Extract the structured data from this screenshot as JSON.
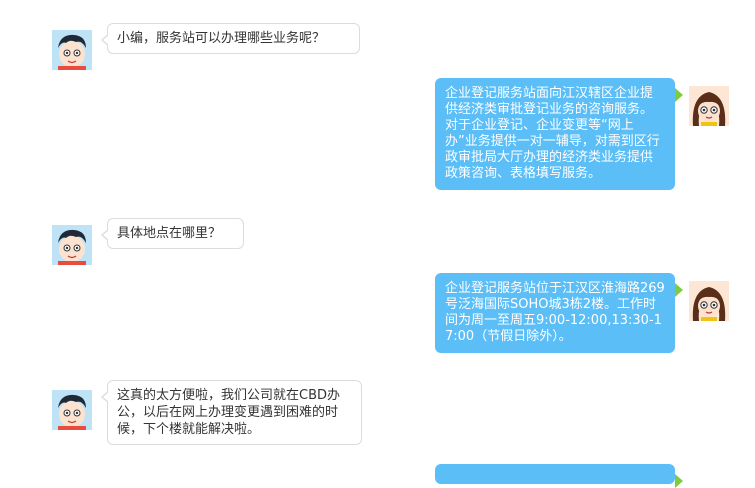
{
  "messages": [
    {
      "side": "user",
      "text": "小编，服务站可以办理哪些业务呢？"
    },
    {
      "side": "agent",
      "text": "企业登记服务站面向江汉辖区企业提供经济类审批登记业务的咨询服务。对于企业登记、企业变更等“网上办”业务提供一对一辅导，对需到区行政审批局大厅办理的经济类业务提供政策咨询、表格填写服务。"
    },
    {
      "side": "user",
      "text": "具体地点在哪里？"
    },
    {
      "side": "agent",
      "text": "企业登记服务站位于江汉区淮海路269号泛海国际SOHO城3栋2楼。工作时间为周一至周五9:00-12:00,13:30-17:00（节假日除外）。"
    },
    {
      "side": "user",
      "text": "这真的太方便啦，我们公司就在CBD办公，以后在网上办理变更遇到困难的时候，下个楼就能解决啦。"
    }
  ],
  "colors": {
    "agent_bubble": "#5bbef7",
    "agent_tail": "#7ccc3c",
    "user_bubble_border": "#dcdcdc"
  },
  "icons": {
    "user_avatar": "boy-avatar-icon",
    "agent_avatar": "girl-avatar-icon"
  }
}
